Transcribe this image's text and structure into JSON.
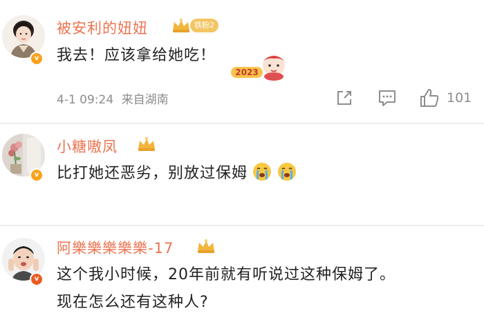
{
  "comments": [
    {
      "username": "被安利的妞妞",
      "level_badge": "铁粉2",
      "verified_badge": "v",
      "text": "我去！应该拿给她吃！",
      "sticker_text": "2023",
      "timestamp": "4-1 09:24",
      "source": "来自湖南",
      "likes": "101"
    },
    {
      "username": "小糖嗷凤",
      "verified_badge": "v",
      "text": "比打她还恶劣，别放过保姆"
    },
    {
      "username": "阿樂樂樂樂樂-17",
      "verified_badge": "v",
      "text_line1": "这个我小时候，20年前就有听说过这种保姆了。",
      "text_line2": "现在怎么还有这种人?"
    }
  ],
  "icons": {
    "share": "share-icon",
    "comment": "comment-icon",
    "like": "thumbs-up-icon",
    "crown": "crown-badge-icon",
    "crying": "crying-emoji-icon"
  },
  "colors": {
    "username": "#eb7350",
    "text": "#222222",
    "meta": "#8c8c8c",
    "divider": "#ededed",
    "badge_orange": "#f7a21b",
    "badge_red": "#ea5c23"
  }
}
